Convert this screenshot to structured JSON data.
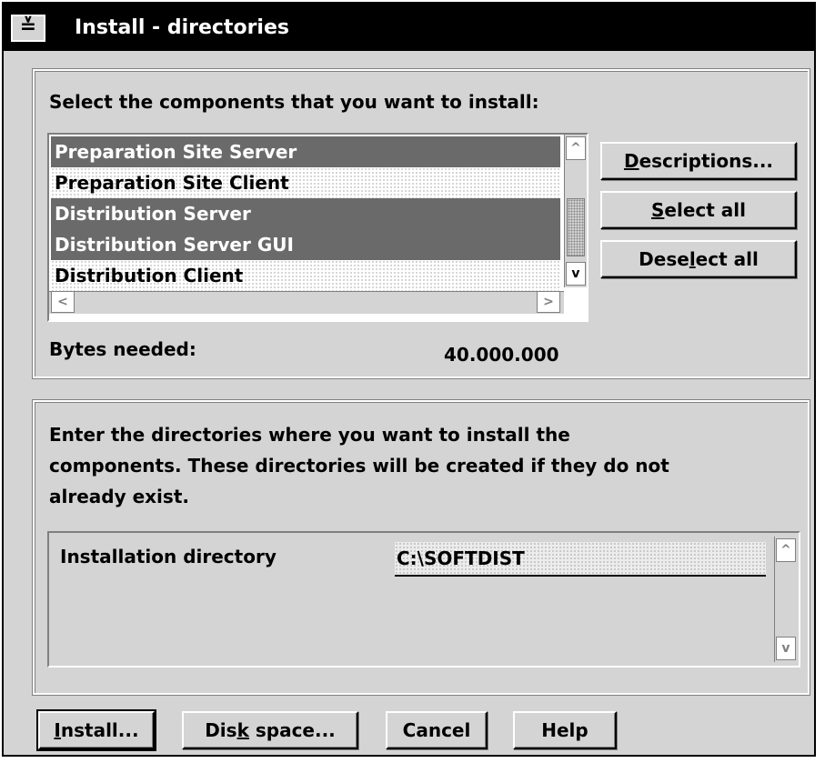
{
  "window": {
    "title": "Install - directories",
    "sysmenu_glyph": "≚"
  },
  "components": {
    "prompt": "Select the components that you want to install:",
    "items": [
      {
        "label": "Preparation Site Server",
        "selected": true
      },
      {
        "label": "Preparation Site Client",
        "selected": false
      },
      {
        "label": "Distribution Server",
        "selected": true
      },
      {
        "label": "Distribution Server GUI",
        "selected": true
      },
      {
        "label": "Distribution Client",
        "selected": false
      }
    ],
    "bytes_label": "Bytes needed:",
    "bytes_value": "40.000.000"
  },
  "side_buttons": {
    "descriptions_mnemonic": "D",
    "descriptions_rest": "escriptions...",
    "select_all_mnemonic": "S",
    "select_all_rest": "elect all",
    "deselect_pre": "Dese",
    "deselect_mnemonic": "l",
    "deselect_post": "ect all"
  },
  "directories": {
    "instructions_line1": "Enter the directories where you want to install the",
    "instructions_line2": "components.  These directories will be created if they do not",
    "instructions_line3": "already exist.",
    "install_dir_label": "Installation directory",
    "install_dir_value": "C:\\SOFTDIST"
  },
  "bottom_buttons": {
    "install_mnemonic": "I",
    "install_rest": "nstall...",
    "disk_pre": "Dis",
    "disk_mnemonic": "k",
    "disk_post": " space...",
    "cancel": "Cancel",
    "help": "Help"
  },
  "icons": {
    "scroll_up": "^",
    "scroll_down": "v",
    "scroll_left": "<",
    "scroll_right": ">"
  },
  "colors": {
    "selected_bg": "#6a6a6a",
    "window_bg": "#d4d4d4",
    "titlebar_bg": "#000000"
  }
}
